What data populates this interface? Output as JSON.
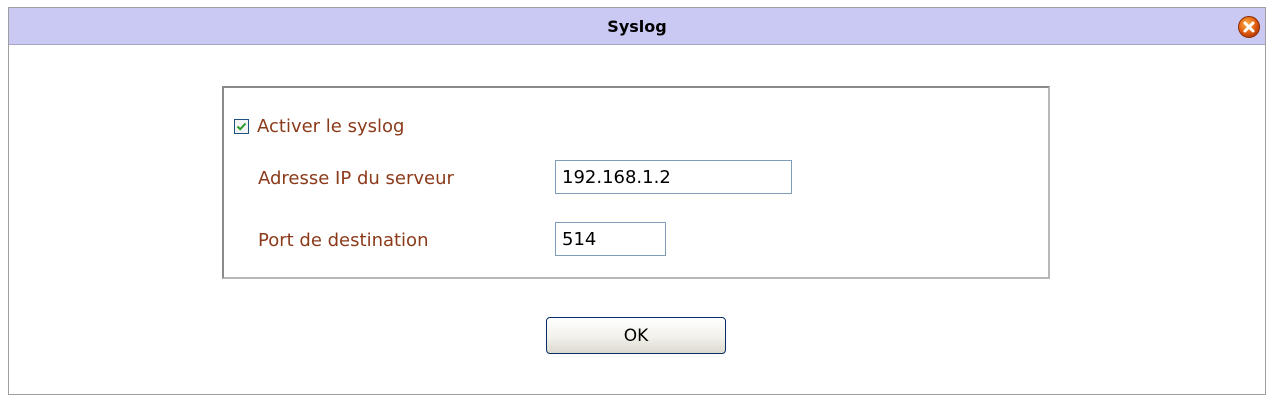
{
  "dialog": {
    "title": "Syslog",
    "close_icon": "close-icon",
    "close_color": "#e35a16"
  },
  "form": {
    "enable_label": "Activer le syslog",
    "enable_checked": true,
    "server_ip_label": "Adresse IP du serveur",
    "server_ip_value": "192.168.1.2",
    "port_label": "Port de destination",
    "port_value": "514"
  },
  "buttons": {
    "ok_label": "OK"
  },
  "colors": {
    "titlebar": "#c9c9f3",
    "label_text": "#8b3a1a",
    "check_mark": "#2a9a2a"
  }
}
